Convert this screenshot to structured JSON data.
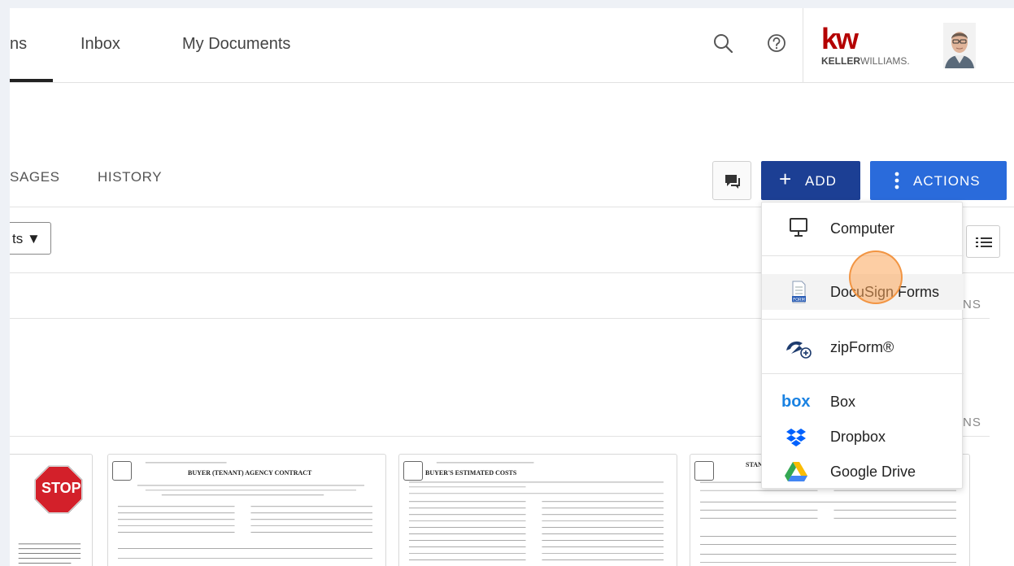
{
  "nav": {
    "tabs": [
      {
        "label": "ns"
      },
      {
        "label": "Inbox"
      },
      {
        "label": "My Documents"
      }
    ]
  },
  "brand": {
    "logo_mark": "kw",
    "logo_text_bold": "KELLER",
    "logo_text_light": "WILLIAMS.",
    "color": "#b40101"
  },
  "subtabs": [
    {
      "label": "SAGES"
    },
    {
      "label": "HISTORY"
    }
  ],
  "toolbar": {
    "add_label": "ADD",
    "actions_label": "ACTIONS"
  },
  "filter": {
    "value": "ts ▼"
  },
  "columns": {
    "truncated_header": "NS"
  },
  "add_menu": {
    "items": [
      {
        "label": "Computer",
        "icon": "monitor-icon"
      },
      {
        "label": "DocuSign Forms",
        "icon": "form-icon"
      },
      {
        "label": "zipForm®",
        "icon": "zipform-icon"
      },
      {
        "label": "Box",
        "icon": "box-icon"
      },
      {
        "label": "Dropbox",
        "icon": "dropbox-icon"
      },
      {
        "label": "Google Drive",
        "icon": "google-drive-icon"
      }
    ]
  },
  "documents": [
    {
      "badge": "STOP"
    },
    {
      "title": "BUYER (TENANT) AGENCY CONTRACT"
    },
    {
      "title": "BUYER'S ESTIMATED COSTS"
    },
    {
      "title": "STAN"
    }
  ],
  "colors": {
    "add_button": "#1c3f94",
    "actions_button": "#2a6bdb"
  }
}
